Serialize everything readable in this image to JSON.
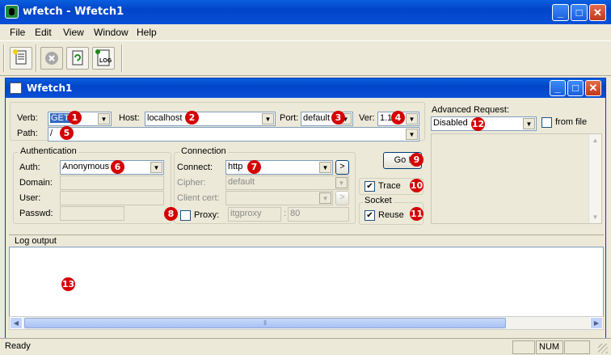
{
  "app": {
    "title": "wfetch - Wfetch1"
  },
  "menu": [
    "File",
    "Edit",
    "View",
    "Window",
    "Help"
  ],
  "toolbar": {
    "icons": [
      "new-document-icon",
      "stop-icon",
      "refresh-icon",
      "new-log-icon"
    ]
  },
  "child": {
    "title": "Wfetch1"
  },
  "request": {
    "verb_label": "Verb:",
    "verb_value": "GET",
    "host_label": "Host:",
    "host_value": "localhost",
    "port_label": "Port:",
    "port_value": "default",
    "ver_label": "Ver:",
    "ver_value": "1.1",
    "path_label": "Path:",
    "path_value": "/"
  },
  "auth": {
    "group": "Authentication",
    "auth_label": "Auth:",
    "auth_value": "Anonymous",
    "domain_label": "Domain:",
    "user_label": "User:",
    "passwd_label": "Passwd:"
  },
  "connection": {
    "group": "Connection",
    "connect_label": "Connect:",
    "connect_value": "http",
    "cipher_label": "Cipher:",
    "cipher_value": "default",
    "cert_label": "Client cert:",
    "proxy_label": "Proxy:",
    "proxy_host": "itgproxy",
    "proxy_sep": ":",
    "proxy_port": "80",
    "arrow": ">"
  },
  "actions": {
    "go_label": "Go !",
    "trace_label": "Trace",
    "trace_checked": true,
    "socket_group": "Socket",
    "reuse_label": "Reuse",
    "reuse_checked": true
  },
  "advanced": {
    "label": "Advanced Request:",
    "value": "Disabled",
    "from_file_label": "from file"
  },
  "log": {
    "label": "Log output"
  },
  "badges": [
    "1",
    "2",
    "3",
    "4",
    "5",
    "6",
    "7",
    "8",
    "9",
    "10",
    "11",
    "12",
    "13"
  ],
  "status": {
    "text": "Ready",
    "num": "NUM"
  },
  "colors": {
    "titlebar": "#0a5fe0",
    "badge": "#d40000",
    "selection": "#316ac5"
  }
}
